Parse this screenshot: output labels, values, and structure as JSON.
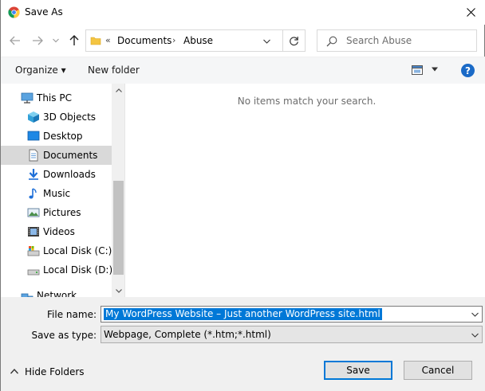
{
  "window": {
    "title": "Save As",
    "close_icon": "close-icon",
    "app_icon": "chrome-icon"
  },
  "nav": {
    "back_icon": "arrow-left-icon",
    "forward_icon": "arrow-right-icon",
    "recent_icon": "chevron-down-icon",
    "up_icon": "arrow-up-icon",
    "address": {
      "overflow": "«",
      "crumbs": [
        "Documents",
        "Abuse"
      ],
      "separator": "›"
    },
    "refresh_icon": "refresh-icon",
    "search_placeholder": "Search Abuse"
  },
  "toolbar": {
    "organize_label": "Organize ▾",
    "new_folder_label": "New folder",
    "view_icon": "view-options-icon",
    "help_label": "?"
  },
  "navpane": {
    "items": [
      {
        "label": "This PC",
        "icon": "computer-icon"
      },
      {
        "label": "3D Objects",
        "icon": "cube-icon"
      },
      {
        "label": "Desktop",
        "icon": "desktop-icon"
      },
      {
        "label": "Documents",
        "icon": "document-icon",
        "selected": true
      },
      {
        "label": "Downloads",
        "icon": "download-icon"
      },
      {
        "label": "Music",
        "icon": "music-icon"
      },
      {
        "label": "Pictures",
        "icon": "picture-icon"
      },
      {
        "label": "Videos",
        "icon": "video-icon"
      },
      {
        "label": "Local Disk (C:)",
        "icon": "drive-c-icon"
      },
      {
        "label": "Local Disk (D:)",
        "icon": "drive-d-icon"
      },
      {
        "label": "Network",
        "icon": "network-icon"
      }
    ]
  },
  "content": {
    "empty_message": "No items match your search."
  },
  "form": {
    "filename_label": "File name:",
    "filename_value": "My WordPress Website – Just another WordPress site.html",
    "savetype_label": "Save as type:",
    "savetype_value": "Webpage, Complete (*.htm;*.html)",
    "hide_folders_label": "Hide Folders",
    "save_label": "Save",
    "cancel_label": "Cancel"
  },
  "colors": {
    "accent": "#0078d7",
    "selection": "#d9d9d9",
    "toolbar_bg": "#f5f6f7",
    "footer_bg": "#f0f0f0"
  }
}
